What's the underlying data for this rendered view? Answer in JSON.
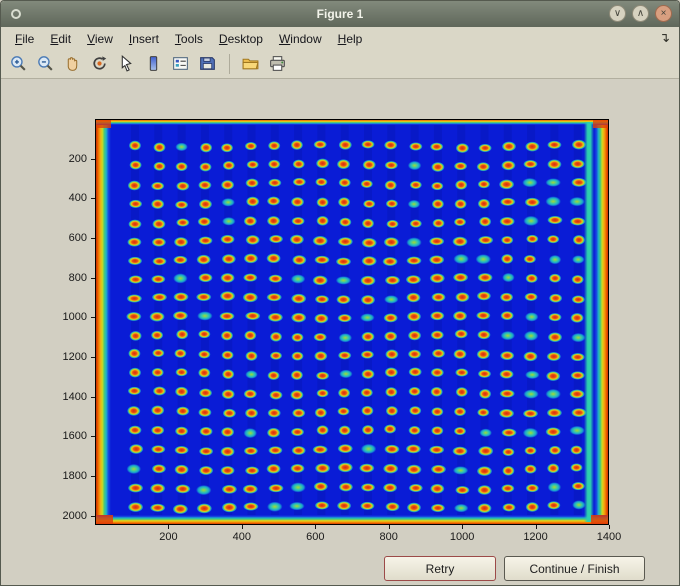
{
  "window": {
    "title": "Figure 1",
    "controls": [
      {
        "name": "minimize-button",
        "glyph": "∨"
      },
      {
        "name": "maximize-button",
        "glyph": "∧"
      },
      {
        "name": "close-button",
        "glyph": "×"
      }
    ]
  },
  "menubar": {
    "items": [
      "File",
      "Edit",
      "View",
      "Insert",
      "Tools",
      "Desktop",
      "Window",
      "Help"
    ],
    "dock_glyph": "↴"
  },
  "toolbar": {
    "buttons": [
      "zoom-in-icon",
      "zoom-out-icon",
      "pan-hand-icon",
      "rotate-3d-icon",
      "data-cursor-icon",
      "colorbar-icon",
      "legend-icon",
      "save-icon",
      "separator",
      "open-folder-icon",
      "print-icon"
    ]
  },
  "chart_data": {
    "type": "heatmap",
    "title": "",
    "xlabel": "",
    "ylabel": "",
    "x_ticks": [
      200,
      400,
      600,
      800,
      1000,
      1200,
      1400
    ],
    "y_ticks": [
      200,
      400,
      600,
      800,
      1000,
      1200,
      1400,
      1600,
      1800,
      2000
    ],
    "x_range": [
      0,
      1400
    ],
    "y_range": [
      0,
      2046
    ],
    "grid": {
      "rows": 20,
      "cols": 20
    },
    "colormap": "jet",
    "grid_lines": false,
    "colors": {
      "background": "#0a1cd6",
      "spot_core": "#d8290d",
      "spot_ring": "#f2ab17",
      "edge_hot": "#d23700",
      "cool_band": "#2ccfae"
    }
  },
  "buttons": [
    {
      "label": "Retry"
    },
    {
      "label": "Continue / Finish"
    }
  ]
}
